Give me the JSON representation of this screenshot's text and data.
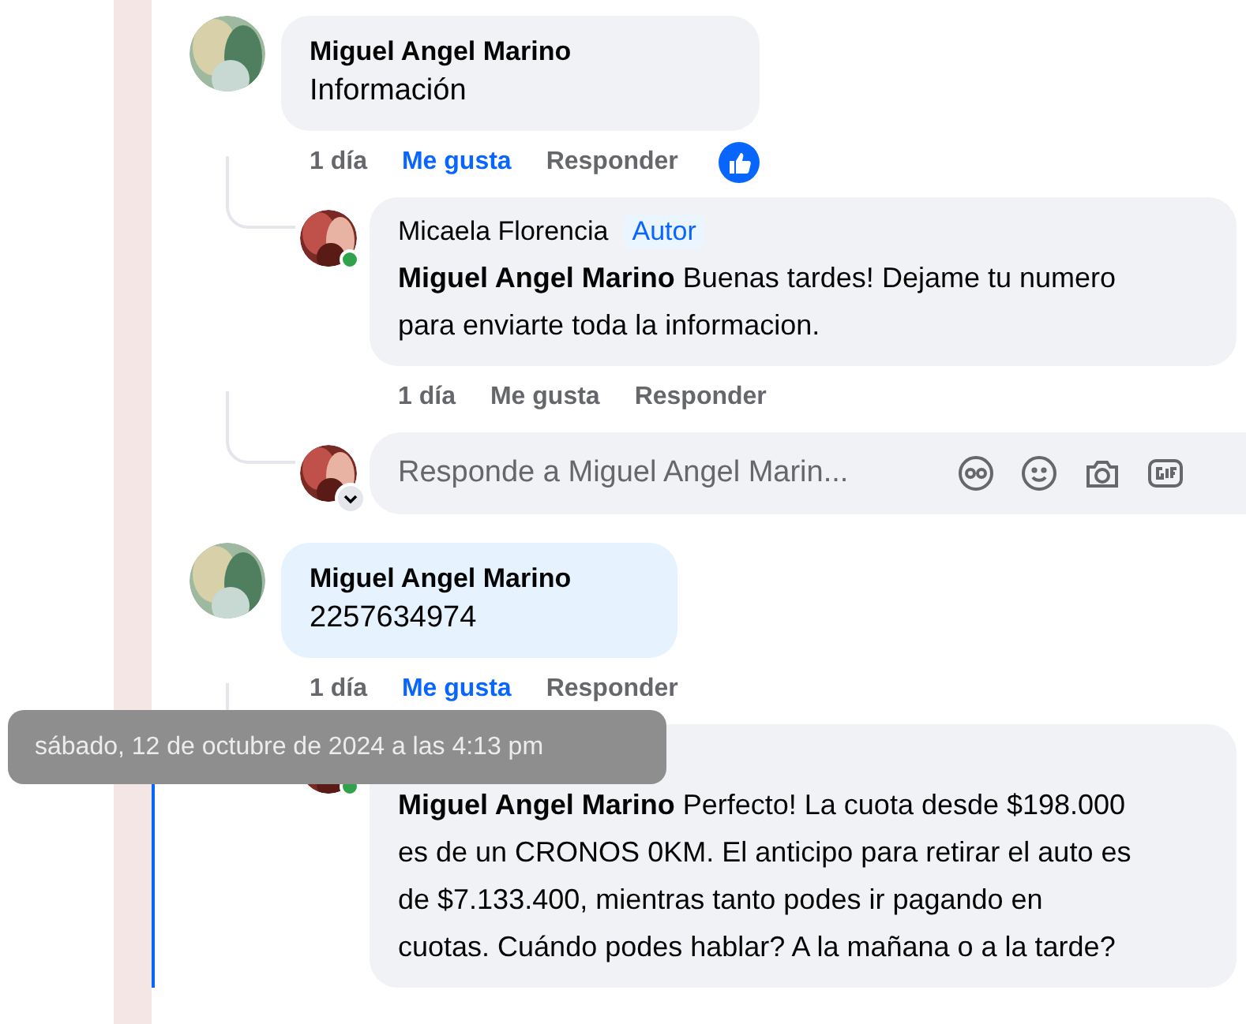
{
  "comments": [
    {
      "author": "Miguel Angel Marino",
      "text": "Información",
      "highlighted": false,
      "time": "1 día",
      "like": "Me gusta",
      "liked": true,
      "reply": "Responder",
      "reacted": true,
      "replies": [
        {
          "author": "Micaela Florencia",
          "badge": "Autor",
          "online": true,
          "mention": "Miguel Angel Marino",
          "text": "Buenas tardes! Dejame tu numero para enviarte toda la informacion.",
          "time": "1 día",
          "like": "Me gusta",
          "liked": false,
          "reply": "Responder"
        }
      ],
      "reply_box": {
        "placeholder": "Responde a Miguel Angel Marin..."
      }
    },
    {
      "author": "Miguel Angel Marino",
      "text": "2257634974",
      "highlighted": true,
      "time": "1 día",
      "like": "Me gusta",
      "liked": true,
      "reply": "Responder",
      "reacted": false,
      "replies": [
        {
          "online": true,
          "mention": "Miguel Angel Marino",
          "text": "Perfecto! La cuota desde $198.000 es de un CRONOS 0KM. El anticipo para retirar el auto es de $7.133.400, mientras tanto podes ir pagando en cuotas. Cuándo podes hablar? A la mañana o a la tarde?"
        }
      ]
    }
  ],
  "tooltip": {
    "text": "sábado, 12 de octubre de 2024 a las 4:13 pm"
  }
}
